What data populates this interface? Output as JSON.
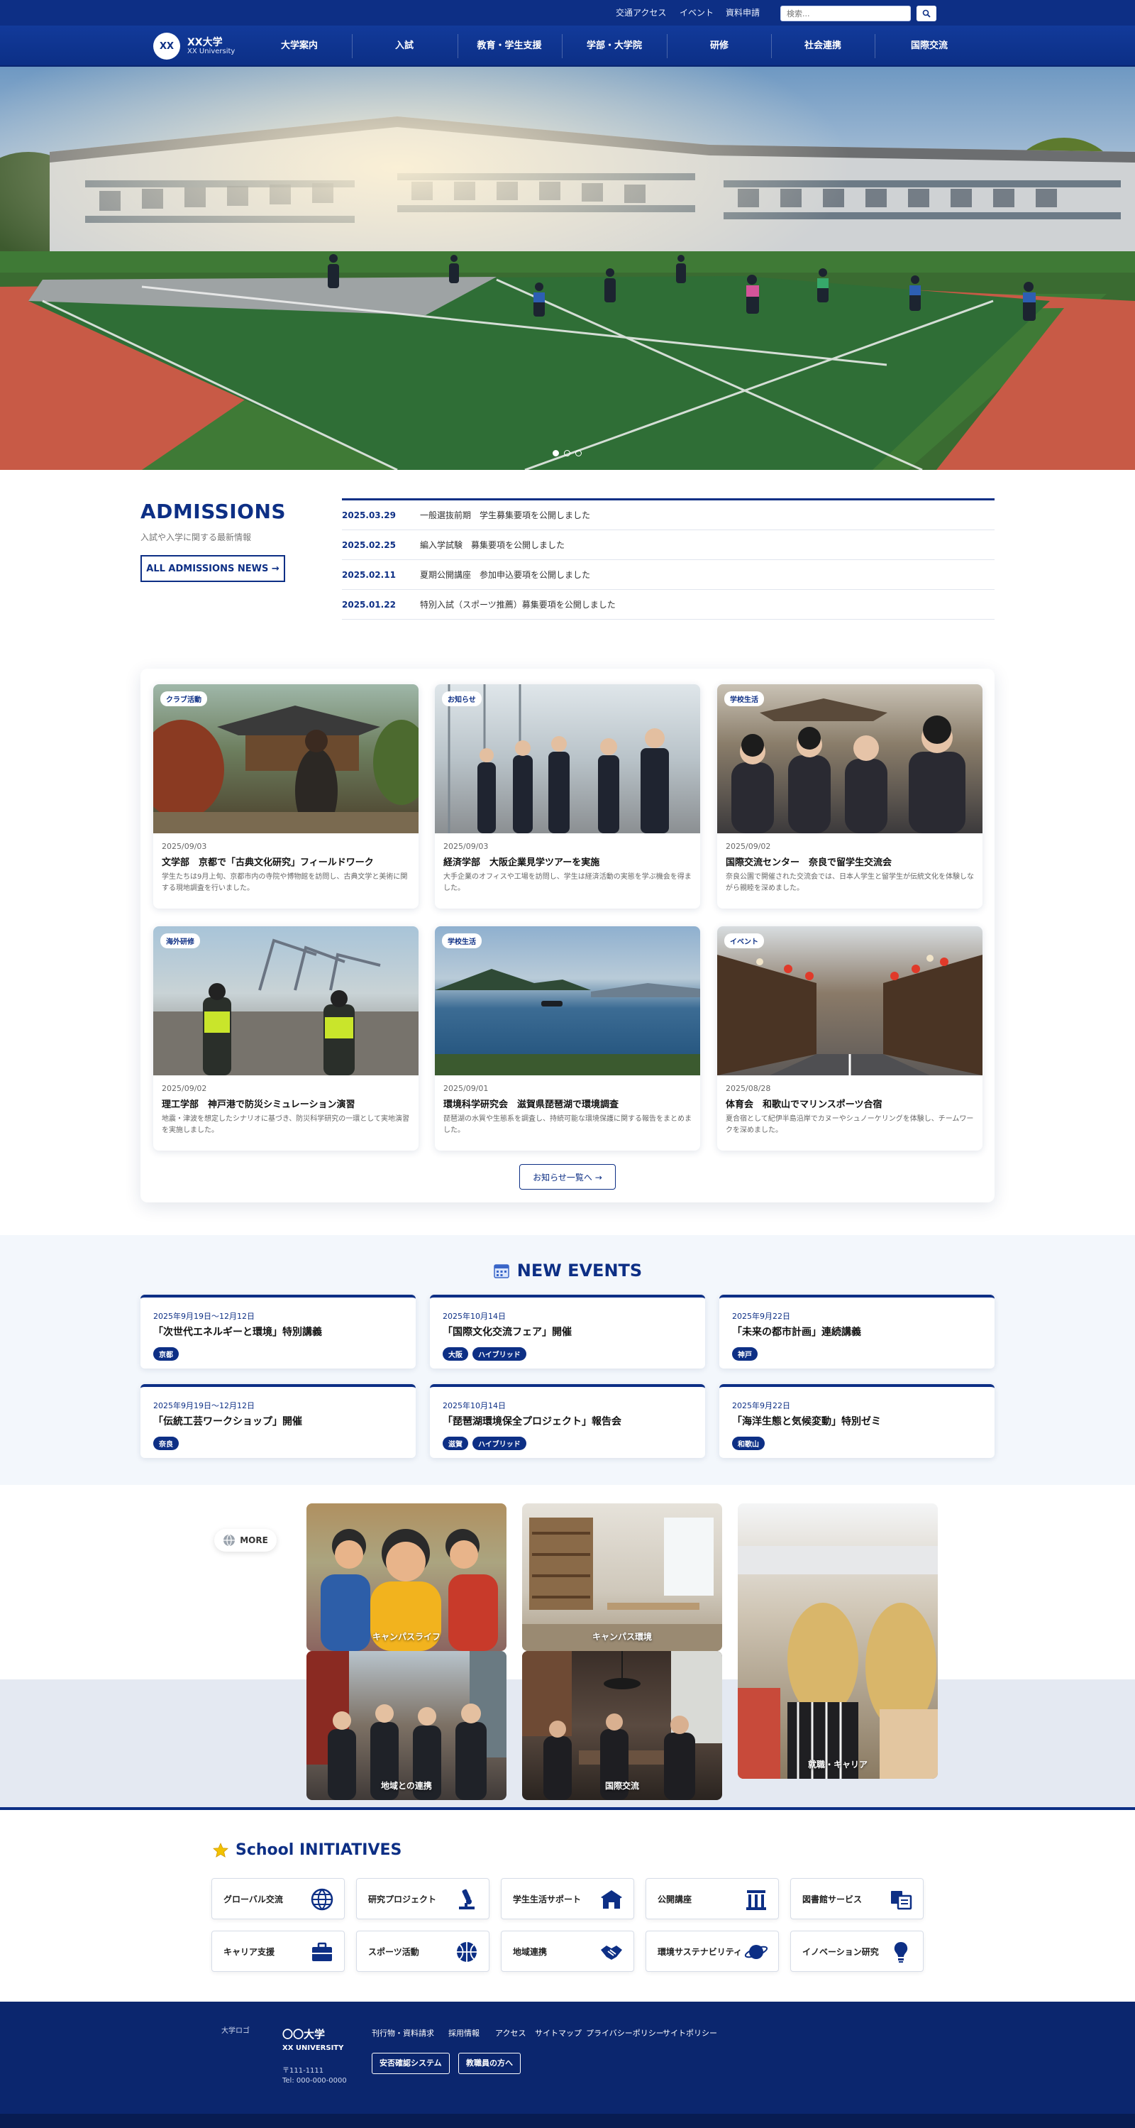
{
  "header": {
    "utility_links": [
      "交通アクセス",
      "イベント",
      "資料申請"
    ],
    "search_placeholder": "検索...",
    "logo_mark": "XX",
    "logo_name": "XX大学",
    "logo_sub": "XX University",
    "nav": [
      "大学案内",
      "入試",
      "教育・学生支援",
      "学部・大学院",
      "研修",
      "社会連携",
      "国際交流"
    ]
  },
  "hero": {
    "slide_count": 3,
    "active_slide": 1
  },
  "admissions": {
    "title": "ADMISSIONS",
    "subtitle": "入試や入学に関する最新情報",
    "button": "ALL ADMISSIONS NEWS →",
    "news": [
      {
        "date": "2025.03.29",
        "text": "一般選抜前期　学生募集要項を公開しました"
      },
      {
        "date": "2025.02.25",
        "text": "編入学試験　募集要項を公開しました"
      },
      {
        "date": "2025.02.11",
        "text": "夏期公開講座　参加申込要項を公開しました"
      },
      {
        "date": "2025.01.22",
        "text": "特別入試（スポーツ推薦）募集要項を公開しました"
      }
    ]
  },
  "news": {
    "cards": [
      {
        "badge": "クラブ活動",
        "date": "2025/09/03",
        "title": "文学部　京都で「古典文化研究」フィールドワーク",
        "desc": "学生たちは9月上旬、京都市内の寺院や博物館を訪問し、古典文学と美術に関する現地調査を行いました。"
      },
      {
        "badge": "お知らせ",
        "date": "2025/09/03",
        "title": "経済学部　大阪企業見学ツアーを実施",
        "desc": "大手企業のオフィスや工場を訪問し、学生は経済活動の実態を学ぶ機会を得ました。"
      },
      {
        "badge": "学校生活",
        "date": "2025/09/02",
        "title": "国際交流センター　奈良で留学生交流会",
        "desc": "奈良公園で開催された交流会では、日本人学生と留学生が伝統文化を体験しながら親睦を深めました。"
      },
      {
        "badge": "海外研修",
        "date": "2025/09/02",
        "title": "理工学部　神戸港で防災シミュレーション演習",
        "desc": "地震・津波を想定したシナリオに基づき、防災科学研究の一環として実地演習を実施しました。"
      },
      {
        "badge": "学校生活",
        "date": "2025/09/01",
        "title": "環境科学研究会　滋賀県琵琶湖で環境調査",
        "desc": "琵琶湖の水質や生態系を調査し、持続可能な環境保護に関する報告をまとめました。"
      },
      {
        "badge": "イベント",
        "date": "2025/08/28",
        "title": "体育会　和歌山でマリンスポーツ合宿",
        "desc": "夏合宿として紀伊半島沿岸でカヌーやシュノーケリングを体験し、チームワークを深めました。"
      }
    ],
    "more_button": "お知らせ一覧へ →"
  },
  "events": {
    "title": "NEW EVENTS",
    "items": [
      {
        "date": "2025年9月19日〜12月12日",
        "title": "「次世代エネルギーと環境」特別講義",
        "tags": [
          "京都"
        ]
      },
      {
        "date": "2025年10月14日",
        "title": "「国際文化交流フェア」開催",
        "tags": [
          "大阪",
          "ハイブリッド"
        ]
      },
      {
        "date": "2025年9月22日",
        "title": "「未来の都市計画」連続講義",
        "tags": [
          "神戸"
        ]
      },
      {
        "date": "2025年9月19日〜12月12日",
        "title": "「伝統工芸ワークショップ」開催",
        "tags": [
          "奈良"
        ]
      },
      {
        "date": "2025年10月14日",
        "title": "「琵琶湖環境保全プロジェクト」報告会",
        "tags": [
          "滋賀",
          "ハイブリッド"
        ]
      },
      {
        "date": "2025年9月22日",
        "title": "「海洋生態と気候変動」特別ゼミ",
        "tags": [
          "和歌山"
        ]
      }
    ]
  },
  "more": {
    "button": "MORE",
    "tiles": [
      "キャンパスライフ",
      "キャンパス環境",
      "就職・キャリア",
      "地域との連携",
      "国際交流"
    ]
  },
  "initiatives": {
    "title": "School INITIATIVES",
    "items": [
      {
        "label": "グローバル交流",
        "icon": "globe-icon"
      },
      {
        "label": "研究プロジェクト",
        "icon": "microscope-icon"
      },
      {
        "label": "学生生活サポート",
        "icon": "graduation-cap-icon"
      },
      {
        "label": "公開講座",
        "icon": "lecture-icon"
      },
      {
        "label": "図書館サービス",
        "icon": "library-icon"
      },
      {
        "label": "キャリア支援",
        "icon": "briefcase-icon"
      },
      {
        "label": "スポーツ活動",
        "icon": "basketball-icon"
      },
      {
        "label": "地域連携",
        "icon": "handshake-icon"
      },
      {
        "label": "環境サステナビリティ",
        "icon": "planet-icon"
      },
      {
        "label": "イノベーション研究",
        "icon": "lightbulb-icon"
      }
    ]
  },
  "footer": {
    "logo_alt": "大学ロゴ",
    "name": "〇〇大学",
    "name_en": "XX UNIVERSITY",
    "postal": "〒111-1111",
    "tel": "Tel: 000-000-0000",
    "links": [
      "刊行物・資料請求",
      "採用情報",
      "アクセス",
      "サイトマップ",
      "プライバシーポリシー",
      "サイトポリシー"
    ],
    "buttons": [
      "安否確認システム",
      "教職員の方へ"
    ]
  },
  "colors": {
    "brand": "#0d2f85",
    "panel": "#f3f7fc",
    "band": "#e4e9f2"
  }
}
